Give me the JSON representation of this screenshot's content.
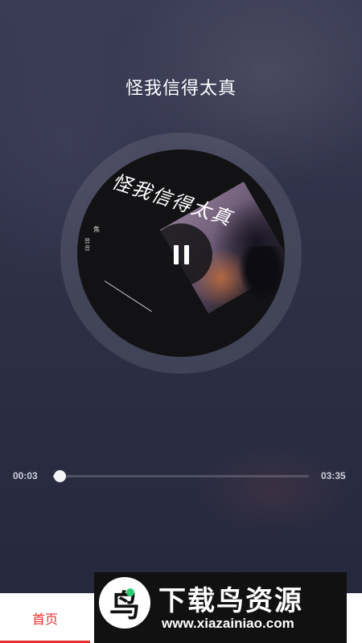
{
  "song": {
    "title": "怪我信得太真"
  },
  "cover": {
    "handwritten_title": "怪我信得太真",
    "artist": "焦",
    "subtitle": "晋音"
  },
  "player": {
    "state": "playing",
    "control_icon": "pause-icon",
    "current_time": "00:03",
    "total_time": "03:35",
    "progress_fraction": 0.014
  },
  "tabbar": {
    "home_label": "首页",
    "active_color": "#e6322d"
  },
  "watermark": {
    "logo_glyph": "鸟",
    "title": "下载鸟资源",
    "url": "www.xiazainiao.com"
  }
}
